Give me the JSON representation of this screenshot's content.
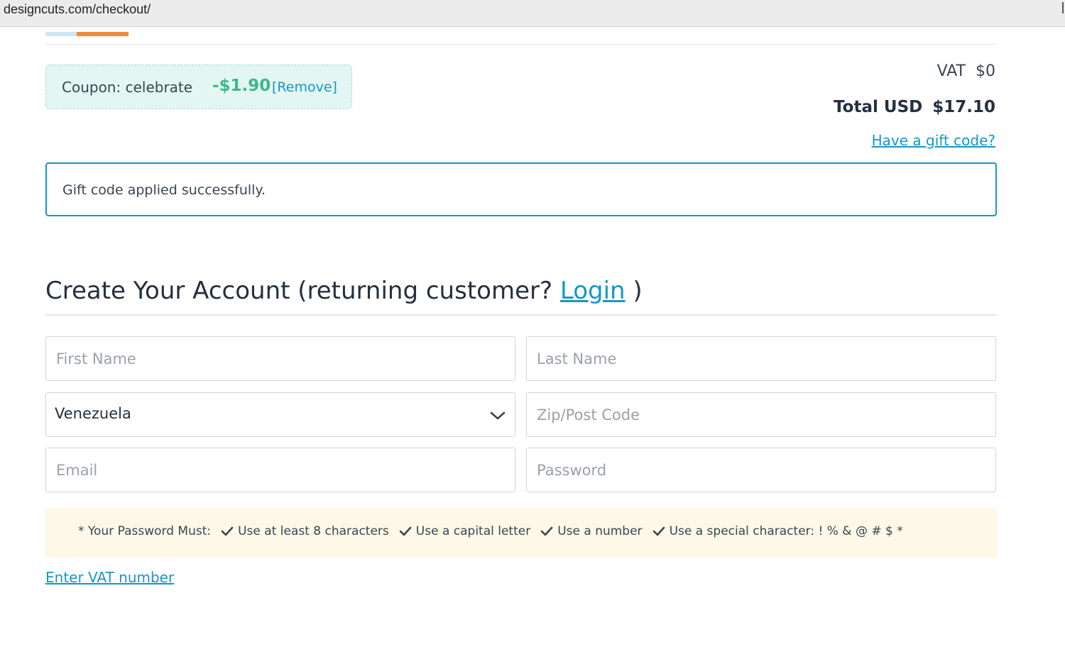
{
  "browser": {
    "url": "designcuts.com/checkout/"
  },
  "coupon": {
    "label": "Coupon: celebrate",
    "amount": "-$1.90",
    "remove": "[Remove]"
  },
  "summary": {
    "vat_label": "VAT",
    "vat_value": "$0",
    "total_label": "Total USD",
    "total_value": "$17.10",
    "gift_link": "Have a gift code?"
  },
  "alert": {
    "message": "Gift code applied successfully."
  },
  "account": {
    "heading_prefix": "Create Your Account (returning customer?",
    "login": "Login",
    "heading_suffix": ")",
    "first_name_placeholder": "First Name",
    "last_name_placeholder": "Last Name",
    "country": "Venezuela",
    "zip_placeholder": "Zip/Post Code",
    "email_placeholder": "Email",
    "password_placeholder": "Password"
  },
  "password_rules": {
    "intro": "* Your Password Must:",
    "rules": [
      "Use at least 8 characters",
      "Use a capital letter",
      "Use a number",
      "Use a special character: ! % & @ # $ *"
    ]
  },
  "vat_link": "Enter VAT number",
  "icons": {
    "check": "check-icon",
    "chevron": "chevron-down-icon"
  },
  "colors": {
    "accent": "#1597c8",
    "coupon_green": "#3db88a",
    "coupon_bg": "#e3f6f1",
    "rules_bg": "#fdf8e7"
  }
}
